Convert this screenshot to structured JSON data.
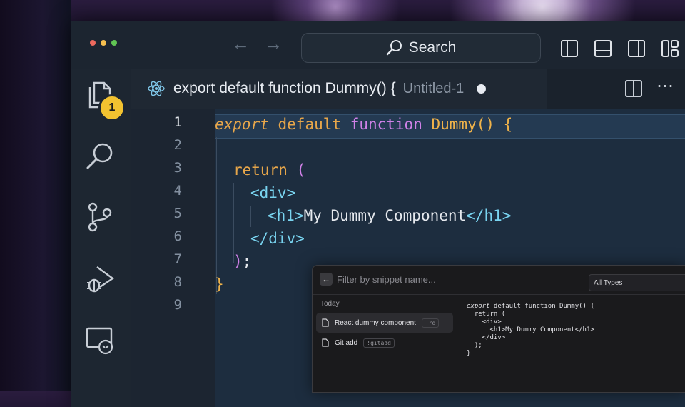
{
  "titlebar": {
    "search_label": "Search",
    "traffic_colors": [
      "#ed6a5e",
      "#f5bf4f",
      "#61c554"
    ]
  },
  "activity_bar": {
    "items": [
      "files-icon",
      "search-icon",
      "source-control-icon",
      "run-debug-icon",
      "remote-explorer-icon"
    ],
    "badge": "1"
  },
  "tab": {
    "title": "export default function Dummy() {",
    "subtitle": "Untitled-1",
    "icon": "react-icon"
  },
  "editor": {
    "line_numbers": [
      "1",
      "2",
      "3",
      "4",
      "5",
      "6",
      "7",
      "8",
      "9"
    ],
    "lines": {
      "l1_export": "export",
      "l1_default": "default",
      "l1_function": "function",
      "l1_name": "Dummy()",
      "l1_brace": "{",
      "l3_return": "return",
      "l3_paren": "(",
      "l4_div": "<div>",
      "l5_open": "<h1>",
      "l5_text": "My Dummy Component",
      "l5_close": "</h1>",
      "l6_div": "</div>",
      "l7_paren": ")",
      "l7_semi": ";",
      "l8_brace": "}"
    }
  },
  "snippet_panel": {
    "filter_placeholder": "Filter by snippet name...",
    "type_select": "All Types",
    "group": "Today",
    "items": [
      {
        "name": "React dummy component",
        "shortcut": "!rd"
      },
      {
        "name": "Git add",
        "shortcut": "!gitadd"
      }
    ],
    "preview": {
      "l1_export": "export",
      "l1_rest": " default function Dummy() {",
      "body": "\n  return (\n    <div>\n      <h1>My Dummy Component</h1>\n    </div>\n  );\n}"
    }
  }
}
